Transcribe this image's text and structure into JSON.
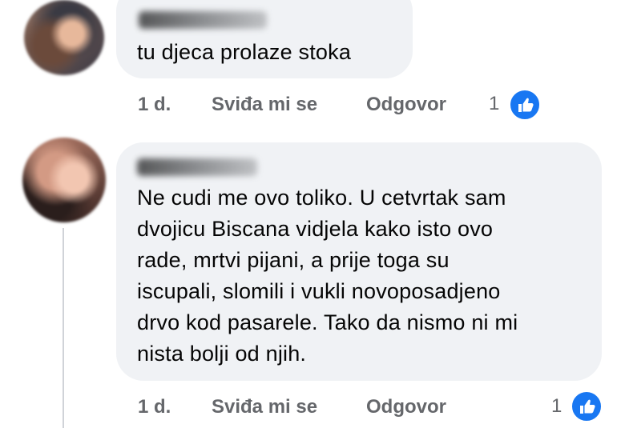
{
  "comments": [
    {
      "text": "tu djeca prolaze stoka",
      "actions": {
        "time": "1 d.",
        "like": "Sviđa mi se",
        "reply": "Odgovor"
      },
      "reactions": {
        "count": "1",
        "icon": "like-thumbs-up-icon",
        "color": "#1877f2"
      }
    },
    {
      "text": "Ne cudi me ovo toliko. U cetvrtak sam\ndvojicu Biscana vidjela kako isto ovo\nrade, mrtvi pijani, a prije toga su\niscupali, slomili i vukli novoposadjeno\ndrvo kod pasarele. Tako da nismo ni mi\nnista bolji od njih.",
      "actions": {
        "time": "1 d.",
        "like": "Sviđa mi se",
        "reply": "Odgovor"
      },
      "reactions": {
        "count": "1",
        "icon": "like-thumbs-up-icon",
        "color": "#1877f2"
      }
    }
  ],
  "theme": {
    "bubble": "#f0f2f5",
    "secondary_text": "#65676b",
    "primary_text": "#050505"
  }
}
